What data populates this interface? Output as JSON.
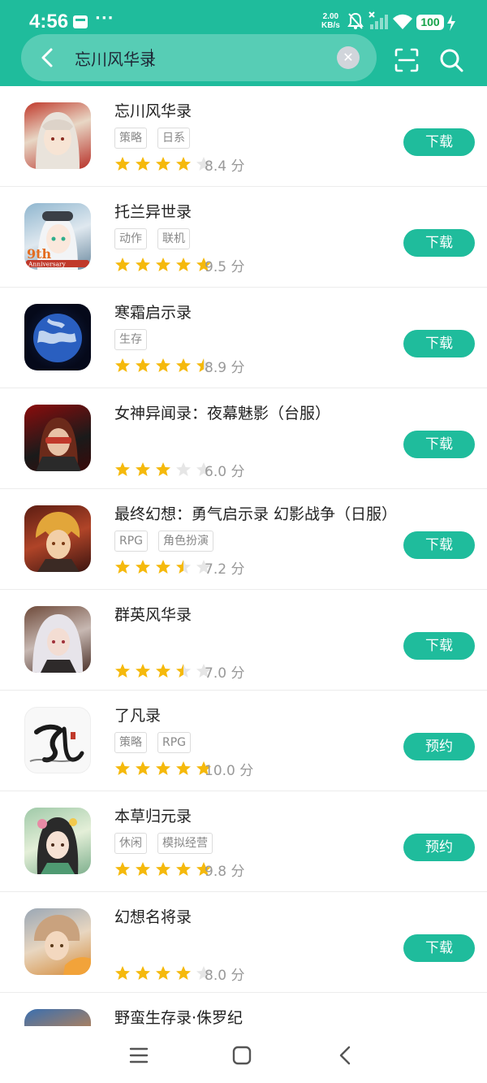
{
  "status_bar": {
    "time": "4:56",
    "overflow": "···",
    "net_speed_value": "2.00",
    "net_speed_unit": "KB/s",
    "battery": "100",
    "icons": [
      "message-icon",
      "mute-bell-icon",
      "signal-off-icon",
      "wifi-icon",
      "charging-icon"
    ]
  },
  "search": {
    "value": "忘川风华录"
  },
  "header_icons": [
    "back-icon",
    "clear-icon",
    "scan-icon",
    "search-icon"
  ],
  "theme": {
    "accent": "#1fbc9c",
    "star": "#f5b90c",
    "star_empty": "#e6e6e6"
  },
  "results": [
    {
      "title": "忘川风华录",
      "tags": [
        "策略",
        "日系"
      ],
      "rating": 4.0,
      "score": "8.4 分",
      "button": "下载",
      "icon": "game-icon-wangchuan"
    },
    {
      "title": "托兰异世录",
      "tags": [
        "动作",
        "联机"
      ],
      "rating": 5.0,
      "score": "9.5 分",
      "button": "下载",
      "icon": "game-icon-tolan",
      "badge_a": "9th",
      "badge_b": "Anniversary"
    },
    {
      "title": "寒霜启示录",
      "tags": [
        "生存"
      ],
      "rating": 4.5,
      "score": "8.9 分",
      "button": "下载",
      "icon": "game-icon-frost"
    },
    {
      "title": "女神异闻录：夜幕魅影（台服）",
      "tags": [],
      "rating": 3.0,
      "score": "6.0 分",
      "button": "下载",
      "icon": "game-icon-persona"
    },
    {
      "title": "最终幻想：勇气启示录 幻影战争（日服）",
      "tags": [
        "RPG",
        "角色扮演"
      ],
      "rating": 3.5,
      "score": "7.2 分",
      "button": "下载",
      "icon": "game-icon-ffbe"
    },
    {
      "title": "群英风华录",
      "tags": [],
      "rating": 3.5,
      "score": "7.0 分",
      "button": "下载",
      "icon": "game-icon-qunying"
    },
    {
      "title": "了凡录",
      "tags": [
        "策略",
        "RPG"
      ],
      "rating": 5.0,
      "score": "10.0 分",
      "button": "预约",
      "icon": "game-icon-liaofan"
    },
    {
      "title": "本草归元录",
      "tags": [
        "休闲",
        "模拟经营"
      ],
      "rating": 5.0,
      "score": "9.8 分",
      "button": "预约",
      "icon": "game-icon-bencao"
    },
    {
      "title": "幻想名将录",
      "tags": [],
      "rating": 4.0,
      "score": "8.0 分",
      "button": "下载",
      "icon": "game-icon-huanxiang"
    },
    {
      "title": "野蛮生存录·侏罗纪",
      "tags": [],
      "rating": 0,
      "score": "",
      "button": "",
      "icon": "game-icon-jurassic"
    }
  ],
  "nav": [
    "menu-icon",
    "home-icon",
    "back-icon"
  ]
}
